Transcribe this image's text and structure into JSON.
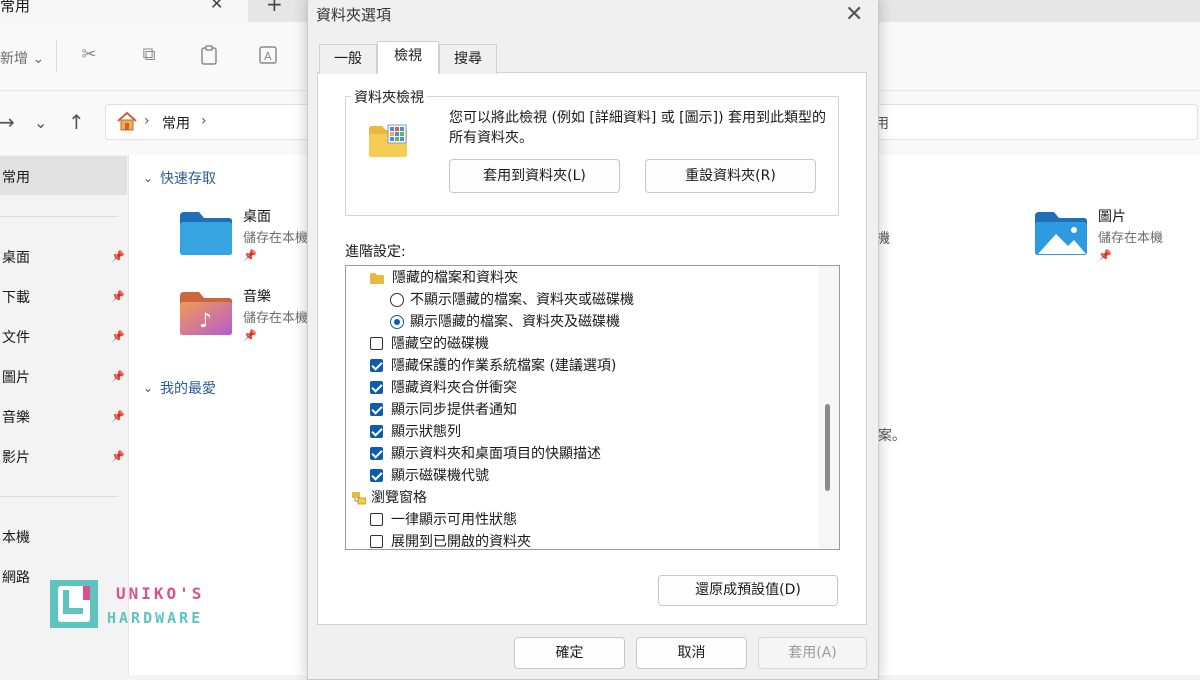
{
  "explorer": {
    "tab_title": "常用",
    "tab_close": "✕",
    "tab_add": "+",
    "toolbar_new": "新增 ⌄",
    "address_path": "常用",
    "address_right_fragment": "用",
    "sidebar": [
      {
        "label": "常用",
        "selected": true,
        "pinned": false
      },
      {
        "label": "桌面",
        "pinned": true
      },
      {
        "label": "下載",
        "pinned": true
      },
      {
        "label": "文件",
        "pinned": true
      },
      {
        "label": "圖片",
        "pinned": true
      },
      {
        "label": "音樂",
        "pinned": true
      },
      {
        "label": "影片",
        "pinned": true
      },
      {
        "label": "本機",
        "pinned": false
      },
      {
        "label": "網路",
        "pinned": false
      }
    ],
    "sections": {
      "quick_access": "快速存取",
      "favorites": "我的最愛"
    },
    "folders": [
      {
        "name": "桌面",
        "location": "儲存在本機"
      },
      {
        "name": "音樂",
        "location": "儲存在本機"
      },
      {
        "name": "圖片",
        "location": "儲存在本機"
      }
    ],
    "fragments": {
      "right_col": "機",
      "notice": "案。"
    }
  },
  "dialog": {
    "title": "資料夾選項",
    "tabs": [
      "一般",
      "檢視",
      "搜尋"
    ],
    "active_tab": "檢視",
    "folder_views": {
      "legend": "資料夾檢視",
      "description": "您可以將此檢視 (例如 [詳細資料] 或 [圖示]) 套用到此類型的所有資料夾。",
      "apply_button": "套用到資料夾(L)",
      "reset_button": "重設資料夾(R)"
    },
    "advanced_label": "進階設定:",
    "advanced_items": [
      {
        "label": "隱藏的檔案和資料夾",
        "type": "folder"
      },
      {
        "label": "不顯示隱藏的檔案、資料夾或磁碟機",
        "type": "radio",
        "checked": false
      },
      {
        "label": "顯示隱藏的檔案、資料夾及磁碟機",
        "type": "radio",
        "checked": true
      },
      {
        "label": "隱藏空的磁碟機",
        "type": "checkbox",
        "checked": false
      },
      {
        "label": "隱藏保護的作業系統檔案 (建議選項)",
        "type": "checkbox",
        "checked": true
      },
      {
        "label": "隱藏資料夾合併衝突",
        "type": "checkbox",
        "checked": true
      },
      {
        "label": "顯示同步提供者通知",
        "type": "checkbox",
        "checked": true
      },
      {
        "label": "顯示狀態列",
        "type": "checkbox",
        "checked": true
      },
      {
        "label": "顯示資料夾和桌面項目的快顯描述",
        "type": "checkbox",
        "checked": true
      },
      {
        "label": "顯示磁碟機代號",
        "type": "checkbox",
        "checked": true
      },
      {
        "label": "瀏覽窗格",
        "type": "group"
      },
      {
        "label": "一律顯示可用性狀態",
        "type": "checkbox",
        "checked": false
      },
      {
        "label": "展開到已開啟的資料夾",
        "type": "checkbox",
        "checked": false
      }
    ],
    "restore_defaults_button": "還原成預設值(D)",
    "ok_button": "確定",
    "cancel_button": "取消",
    "apply_button": "套用(A)"
  },
  "watermark": {
    "line1": "UNIKO'S",
    "line2": "HARDWARE"
  },
  "colors": {
    "accent": "#0b5cad",
    "logo_teal": "#5fc4c0",
    "logo_pink": "#d9518f"
  }
}
